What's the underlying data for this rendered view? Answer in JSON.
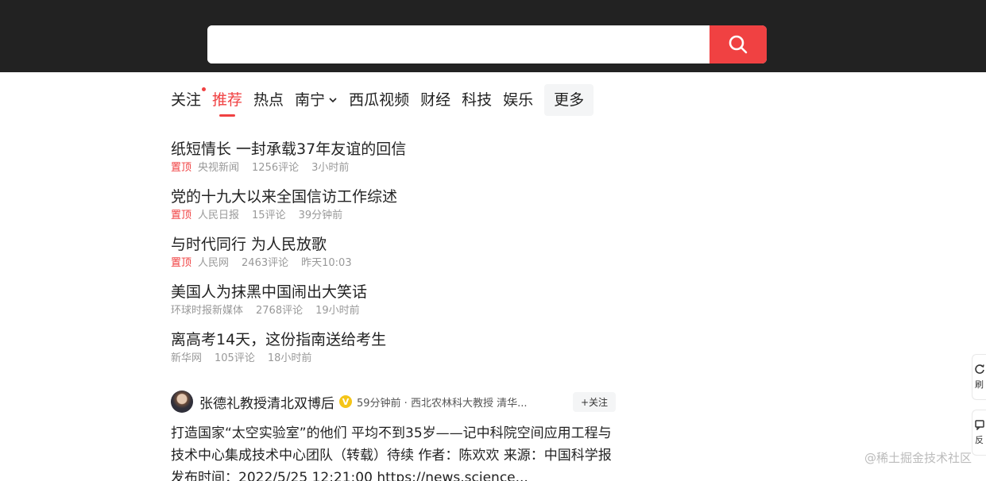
{
  "search": {
    "placeholder": "",
    "value": ""
  },
  "nav": {
    "items": [
      {
        "label": "关注",
        "dot": true
      },
      {
        "label": "推荐",
        "active": true
      },
      {
        "label": "热点"
      },
      {
        "label": "南宁",
        "dropdown": true
      },
      {
        "label": "西瓜视频"
      },
      {
        "label": "财经"
      },
      {
        "label": "科技"
      },
      {
        "label": "娱乐"
      }
    ],
    "more_label": "更多"
  },
  "feed": [
    {
      "title": "纸短情长 一封承载37年友谊的回信",
      "pinned": "置顶",
      "source": "央视新闻",
      "comments": "1256评论",
      "time": "3小时前"
    },
    {
      "title": "党的十九大以来全国信访工作综述",
      "pinned": "置顶",
      "source": "人民日报",
      "comments": "15评论",
      "time": "39分钟前"
    },
    {
      "title": "与时代同行 为人民放歌",
      "pinned": "置顶",
      "source": "人民网",
      "comments": "2463评论",
      "time": "昨天10:03"
    },
    {
      "title": "美国人为抹黑中国闹出大笑话",
      "pinned": "",
      "source": "环球时报新媒体",
      "comments": "2768评论",
      "time": "19小时前"
    },
    {
      "title": "离高考14天，这份指南送给考生",
      "pinned": "",
      "source": "新华网",
      "comments": "105评论",
      "time": "18小时前"
    }
  ],
  "post": {
    "author": "张德礼教授清北双博后",
    "verified_badge": "V",
    "subtitle": "59分钟前 · 西北农林科大教授 清华...",
    "follow_label": "+关注",
    "body": "打造国家“太空实验室”的他们 平均不到35岁——记中科院空间应用工程与技术中心集成技术中心团队（转载）待续 作者：陈欢欢 来源：中国科学报 发布时间：2022/5/25 12:21:00 https://news.science..."
  },
  "side": {
    "refresh_label": "刷",
    "feedback_label": "反"
  },
  "watermark": "@稀土掘金技术社区",
  "colors": {
    "accent": "#f04142",
    "topbar": "#222222"
  }
}
